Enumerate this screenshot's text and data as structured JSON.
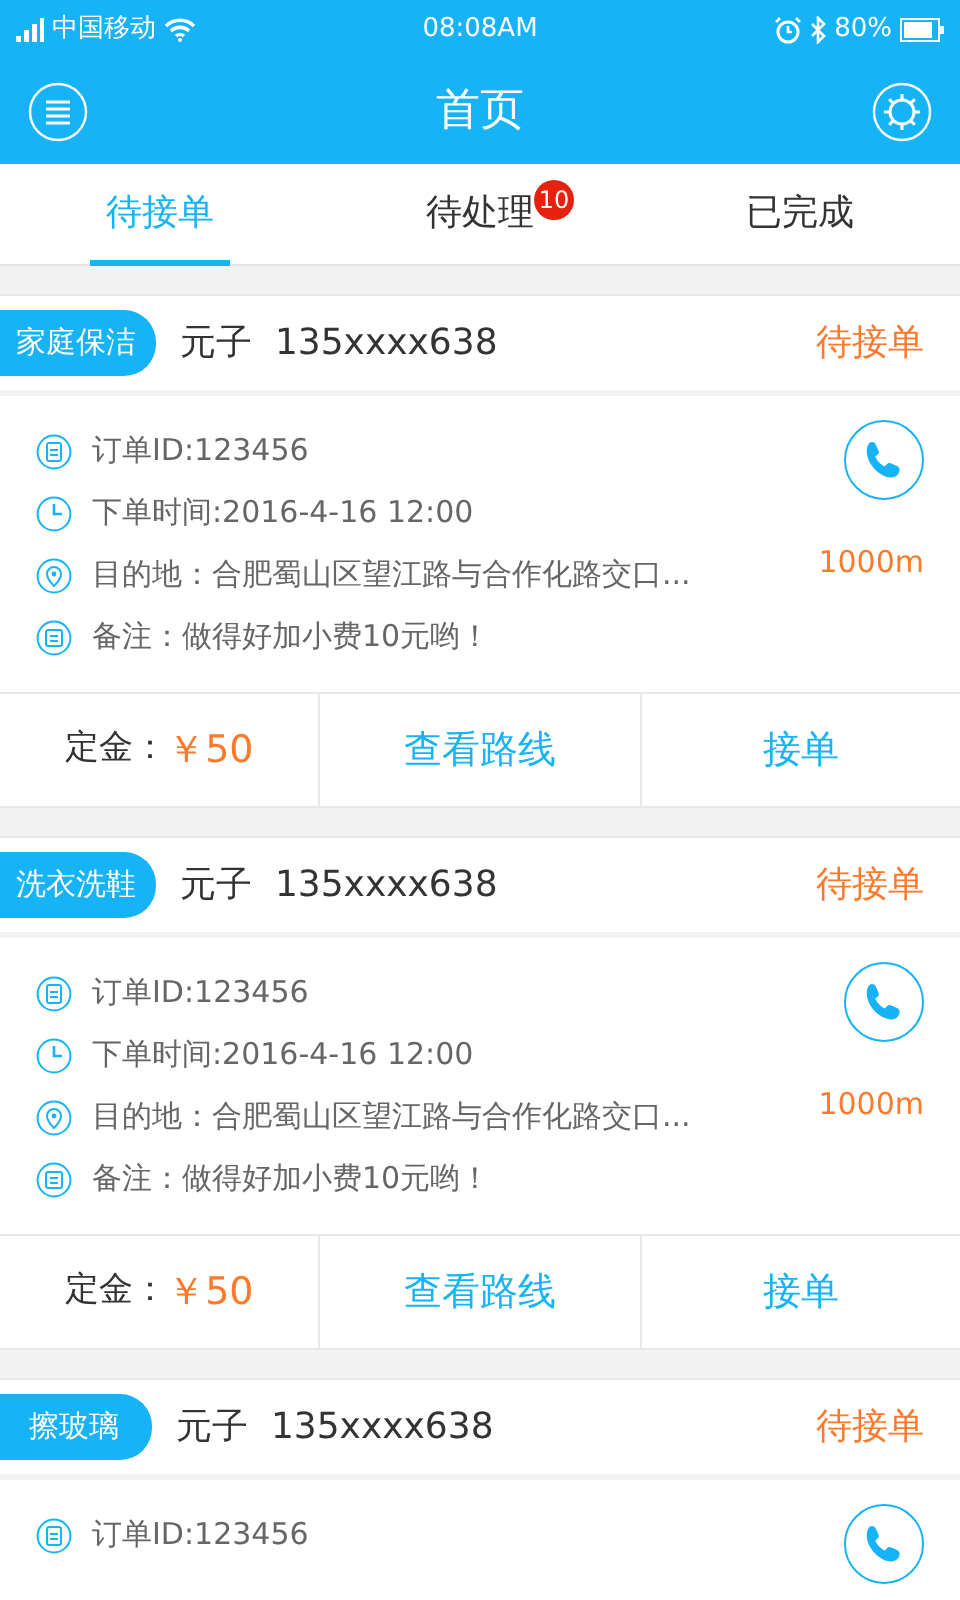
{
  "status_bar": {
    "carrier": "中国移动",
    "time": "08:08AM",
    "battery": "80%"
  },
  "header": {
    "title": "首页"
  },
  "tabs": [
    {
      "label": "待接单",
      "selected": true
    },
    {
      "label": "待处理",
      "selected": false,
      "badge": "10"
    },
    {
      "label": "已完成",
      "selected": false
    }
  ],
  "orders": [
    {
      "category": "家庭保洁",
      "customer": "元子",
      "phone": "135xxxx638",
      "status": "待接单",
      "order_id": "订单ID:123456",
      "time": "下单时间:2016-4-16 12:00",
      "destination": "目的地：合肥蜀山区望江路与合作化路交口...",
      "distance": "1000m",
      "note": "备注：做得好加小费10元哟！",
      "deposit_label": "定金：",
      "deposit": "￥50",
      "route_button": "查看路线",
      "accept_button": "接单"
    },
    {
      "category": "洗衣洗鞋",
      "customer": "元子",
      "phone": "135xxxx638",
      "status": "待接单",
      "order_id": "订单ID:123456",
      "time": "下单时间:2016-4-16 12:00",
      "destination": "目的地：合肥蜀山区望江路与合作化路交口...",
      "distance": "1000m",
      "note": "备注：做得好加小费10元哟！",
      "deposit_label": "定金：",
      "deposit": "￥50",
      "route_button": "查看路线",
      "accept_button": "接单"
    },
    {
      "category": "擦玻璃",
      "customer": "元子",
      "phone": "135xxxx638",
      "status": "待接单",
      "order_id": "订单ID:123456"
    }
  ]
}
